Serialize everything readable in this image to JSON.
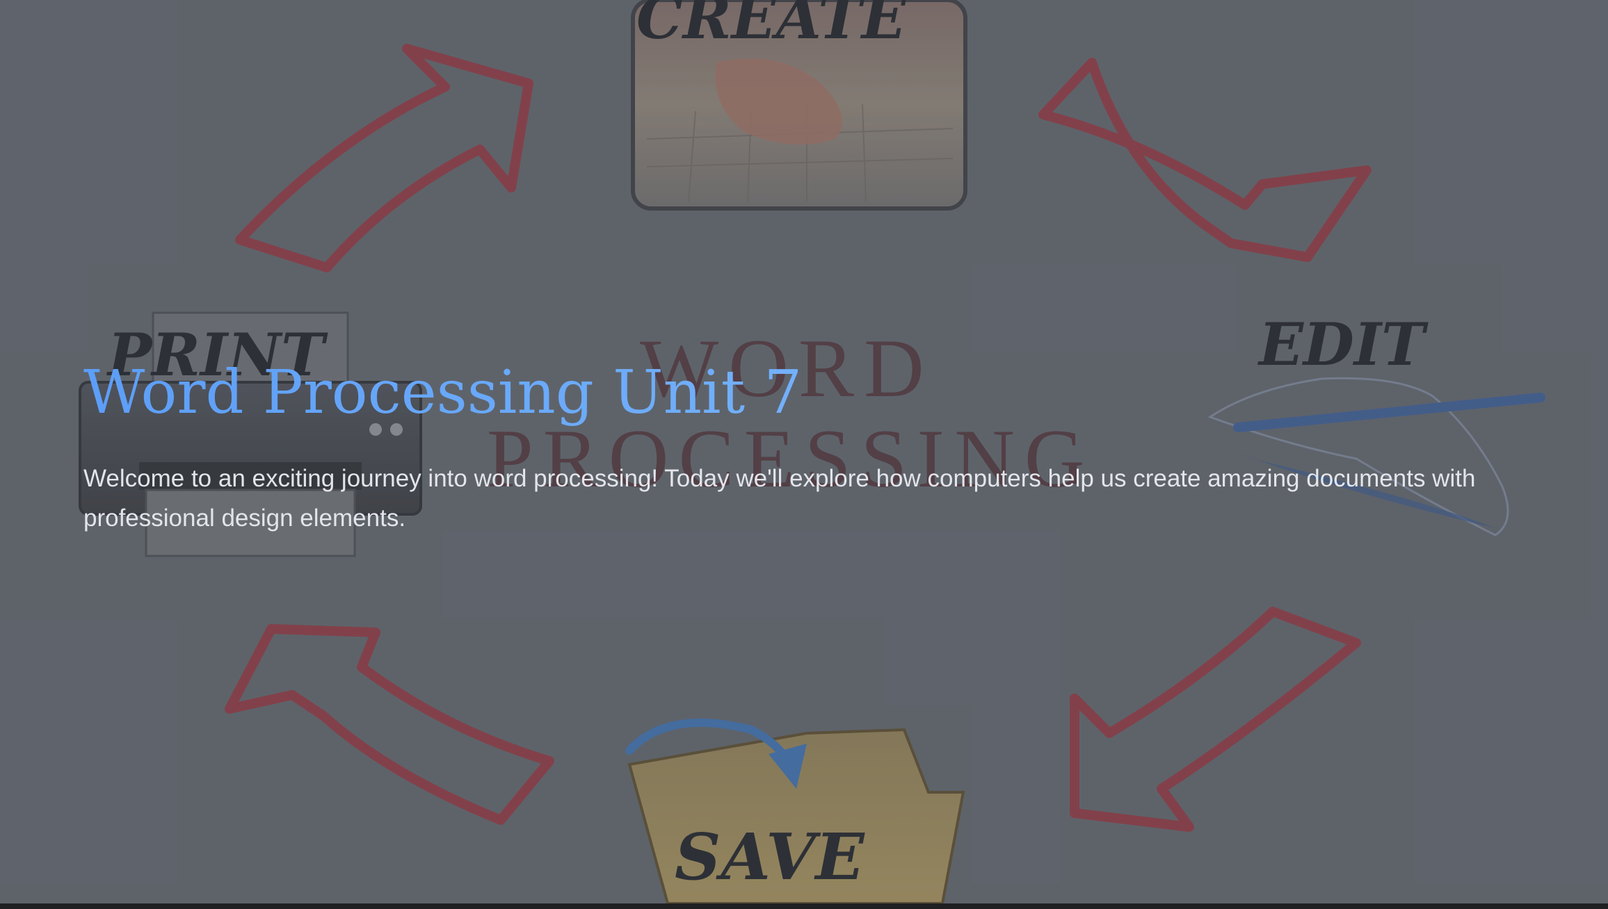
{
  "slide": {
    "title": "Word Processing Unit 7",
    "intro": "Welcome to an exciting journey into word processing! Today we'll explore how computers help us create amazing documents with professional design elements."
  },
  "background": {
    "create_label": "CREATE",
    "edit_label": "EDIT",
    "save_label": "SAVE",
    "print_label": "PRINT",
    "center_line1": "WORD",
    "center_line2": "PROCESSING",
    "icons": [
      "keyboard-typing-icon",
      "hand-writing-pen-icon",
      "save-folder-icon",
      "printer-icon",
      "cycle-arrow-icon"
    ]
  },
  "colors": {
    "slide_bg": "#5f636b",
    "title_accent": "#6aaefc",
    "body_text": "#e3e5ea",
    "arrow_red": "#8a3a44"
  }
}
